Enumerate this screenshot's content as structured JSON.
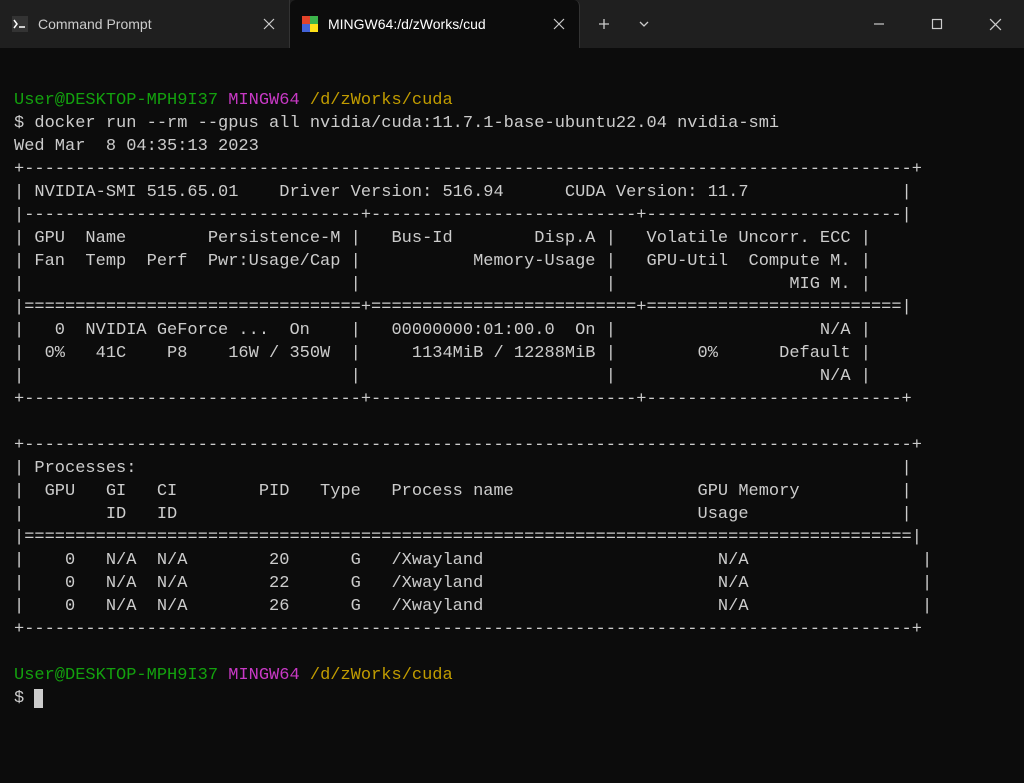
{
  "tabs": {
    "inactive": {
      "label": "Command Prompt"
    },
    "active": {
      "label": "MINGW64:/d/zWorks/cud"
    }
  },
  "terminal": {
    "prompt1_user": "User@DESKTOP-MPH9I37",
    "prompt1_sys": "MINGW64",
    "prompt1_path": "/d/zWorks/cuda",
    "command": "$ docker run --rm --gpus all nvidia/cuda:11.7.1-base-ubuntu22.04 nvidia-smi",
    "timestamp": "Wed Mar  8 04:35:13 2023",
    "nvidia_smi_version": "NVIDIA-SMI 515.65.01",
    "driver_version": "Driver Version: 516.94",
    "cuda_version": "CUDA Version: 11.7",
    "gpu_header": {
      "row1_col1": "GPU  Name        Persistence-M",
      "row1_col2": "Bus-Id        Disp.A",
      "row1_col3": "Volatile Uncorr. ECC",
      "row2_col1": "Fan  Temp  Perf  Pwr:Usage/Cap",
      "row2_col2": "Memory-Usage",
      "row2_col3": "GPU-Util  Compute M.",
      "row3_col3": "MIG M."
    },
    "gpu_data": {
      "row1_col1": "0  NVIDIA GeForce ...  On  ",
      "row1_col2": "00000000:01:00.0  On",
      "row1_col3": "N/A",
      "row2_col1": " 0%   41C    P8    16W / 350W",
      "row2_col2": "1134MiB / 12288MiB",
      "row2_col3": "0%      Default",
      "row3_col3": "N/A"
    },
    "processes_label": "Processes:",
    "proc_header": {
      "row1": "GPU   GI   CI        PID   Type   Process name                  GPU Memory",
      "row2": "ID   ID                                                   Usage     "
    },
    "processes": [
      "    0   N/A  N/A        20      G   /Xwayland                       N/A     ",
      "    0   N/A  N/A        22      G   /Xwayland                       N/A     ",
      "    0   N/A  N/A        26      G   /Xwayland                       N/A     "
    ],
    "prompt2_user": "User@DESKTOP-MPH9I37",
    "prompt2_sys": "MINGW64",
    "prompt2_path": "/d/zWorks/cuda",
    "prompt2_dollar": "$ "
  }
}
